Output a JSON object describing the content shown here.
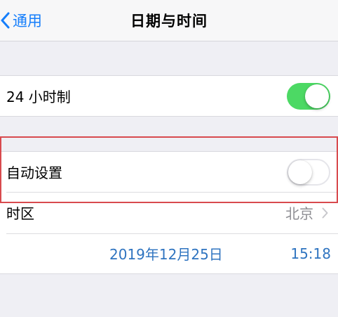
{
  "navbar": {
    "back_label": "通用",
    "title": "日期与时间"
  },
  "settings": {
    "hour24": {
      "label": "24 小时制",
      "enabled": true
    },
    "auto_set": {
      "label": "自动设置",
      "enabled": false
    },
    "timezone": {
      "label": "时区",
      "value": "北京"
    },
    "date": "2019年12月25日",
    "time": "15:18"
  },
  "colors": {
    "accent": "#157efb",
    "toggle_on": "#4cd964",
    "highlight_border": "#d84a4e",
    "date_text": "#2f74c0"
  }
}
